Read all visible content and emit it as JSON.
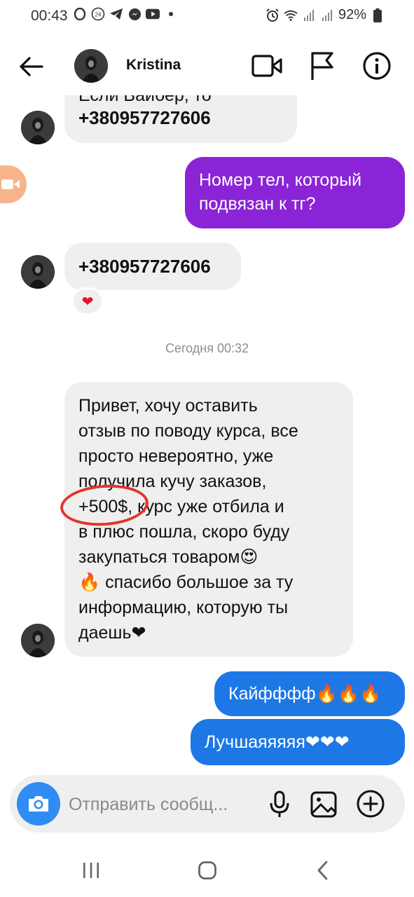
{
  "status_bar": {
    "time": "00:43",
    "battery": "92%"
  },
  "header": {
    "contact_name": "Kristina"
  },
  "messages": {
    "m1_line1": "Если Вайбер, то",
    "m1_line2": "+380957727606",
    "m2_line1": "Номер тел, который",
    "m2_line2": "подвязан к тг?",
    "m3": "+380957727606",
    "m3_reaction": "❤",
    "timestamp": "Сегодня 00:32",
    "m4_lines": [
      "Привет, хочу оставить",
      "отзыв по поводу курса, все",
      "просто невероятно, уже",
      "получила кучу заказов,",
      "+500$, курс уже отбила и",
      "в плюс пошла, скоро буду",
      "закупаться товаром😍",
      "🔥 спасибо большое за ту",
      "информацию, которую ты",
      "даешь❤"
    ],
    "m5": "Кайфффф🔥🔥🔥",
    "m6": "Лучшаяяяяя❤❤❤"
  },
  "composer": {
    "placeholder": "Отправить сообщ..."
  },
  "colors": {
    "outgoing_purple": "#8b24d6",
    "outgoing_blue": "#1d78e6",
    "incoming_gray": "#efefef",
    "annotation_red": "#e5332a"
  }
}
